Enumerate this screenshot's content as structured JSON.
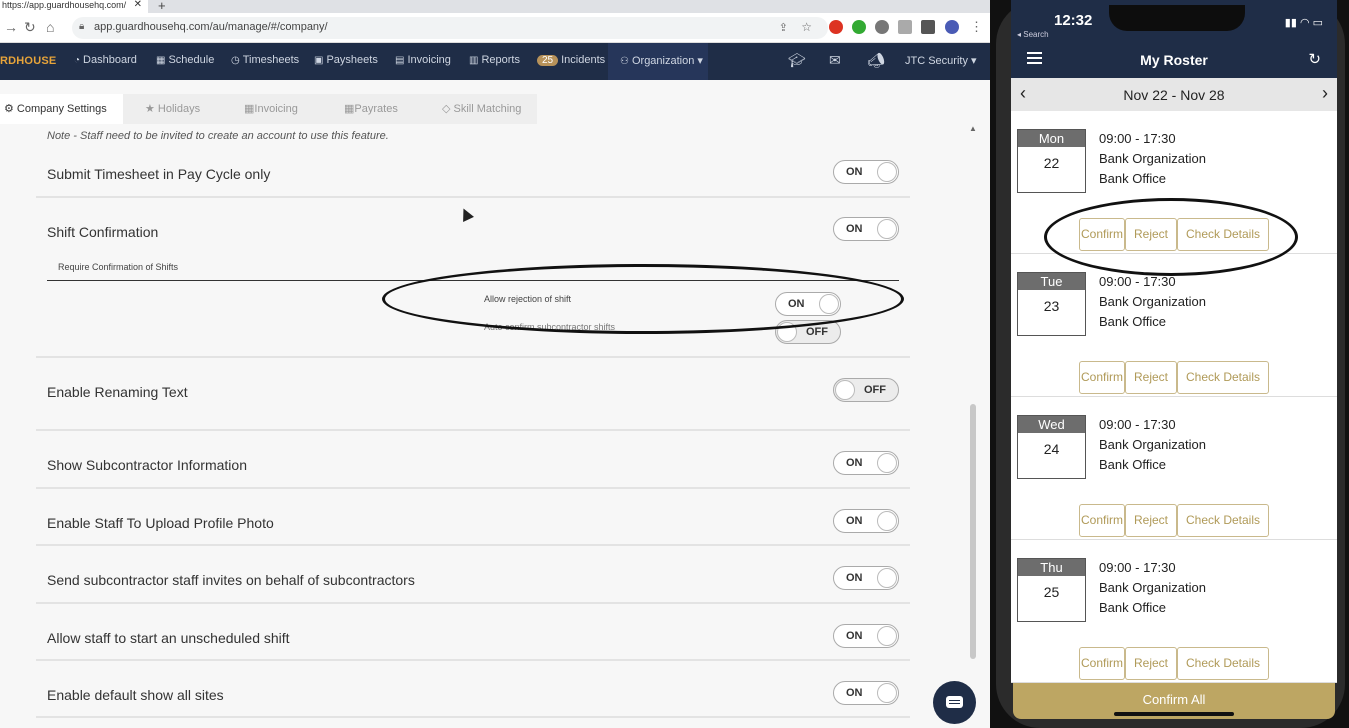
{
  "browser": {
    "tab_title": "https://app.guardhousehq.com/",
    "url": "app.guardhousehq.com/au/manage/#/company/"
  },
  "nav": {
    "brand": "RDHOUSE",
    "dashboard": "Dashboard",
    "schedule": "Schedule",
    "timesheets": "Timesheets",
    "paysheets": "Paysheets",
    "invoicing": "Invoicing",
    "reports": "Reports",
    "incidents_count": "25",
    "incidents": "Incidents",
    "organization": "Organization ▾",
    "account": "JTC Security ▾"
  },
  "subtabs": {
    "company_settings": "⚙ Company Settings",
    "holidays": "★ Holidays",
    "invoicing": "Invoicing",
    "payrates": "Payrates",
    "skill_matching": "◇ Skill Matching"
  },
  "settings": {
    "note": "Note - Staff need to be invited to create an account to use this feature.",
    "submit_timesheet": {
      "label": "Submit Timesheet in Pay Cycle only",
      "state": "ON"
    },
    "shift_confirmation": {
      "label": "Shift Confirmation",
      "state": "ON"
    },
    "require_confirmation": "Require Confirmation of Shifts",
    "allow_rejection": {
      "label": "Allow rejection of shift",
      "state": "ON"
    },
    "auto_confirm": {
      "label": "Auto confirm subcontractor shifts",
      "state": "OFF"
    },
    "enable_renaming": {
      "label": "Enable Renaming Text",
      "state": "OFF"
    },
    "show_subcontractor": {
      "label": "Show Subcontractor Information",
      "state": "ON"
    },
    "upload_photo": {
      "label": "Enable Staff To Upload Profile Photo",
      "state": "ON"
    },
    "send_invites": {
      "label": "Send subcontractor staff invites on behalf of subcontractors",
      "state": "ON"
    },
    "unscheduled_shift": {
      "label": "Allow staff to start an unscheduled shift",
      "state": "ON"
    },
    "show_all_sites": {
      "label": "Enable default show all sites",
      "state": "ON"
    }
  },
  "phone": {
    "clock": "12:32",
    "back_label": "◂ Search",
    "title": "My Roster",
    "week_range": "Nov 22 - Nov 28",
    "shifts": [
      {
        "dow": "Mon",
        "day": "22",
        "time": "09:00 - 17:30",
        "org": "Bank Organization",
        "site": "Bank Office"
      },
      {
        "dow": "Tue",
        "day": "23",
        "time": "09:00 - 17:30",
        "org": "Bank Organization",
        "site": "Bank Office"
      },
      {
        "dow": "Wed",
        "day": "24",
        "time": "09:00 - 17:30",
        "org": "Bank Organization",
        "site": "Bank Office"
      },
      {
        "dow": "Thu",
        "day": "25",
        "time": "09:00 - 17:30",
        "org": "Bank Organization",
        "site": "Bank Office"
      }
    ],
    "confirm_label": "Confirm",
    "reject_label": "Reject",
    "details_label": "Check Details",
    "confirm_all": "Confirm All"
  },
  "colors": {
    "navy": "#1f2d47",
    "gold": "#bda663",
    "brand_orange": "#e7a43a"
  }
}
